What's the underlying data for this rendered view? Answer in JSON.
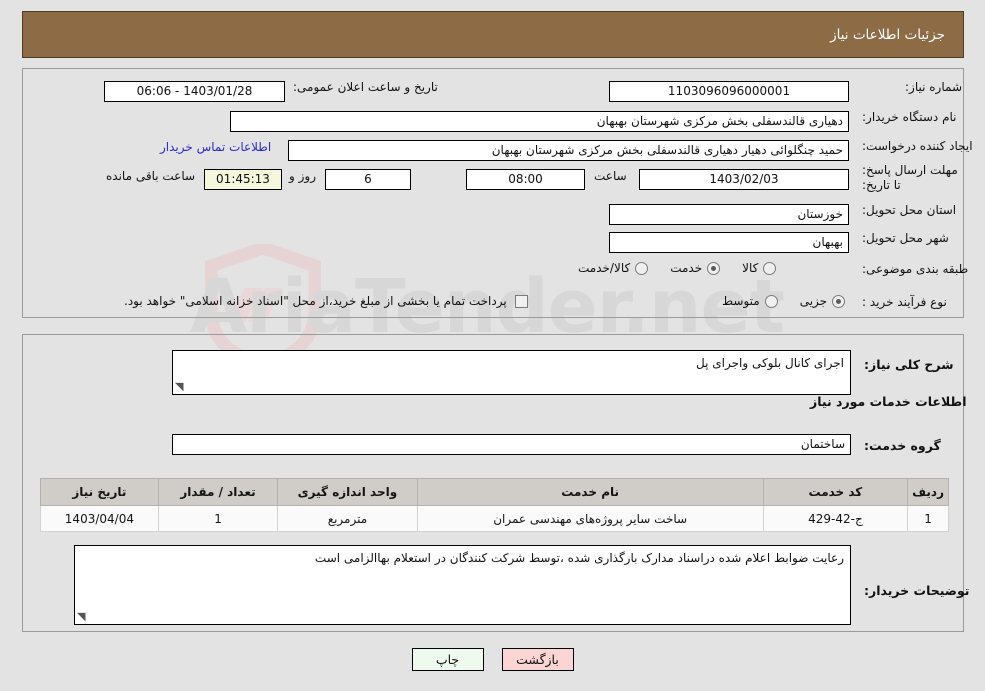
{
  "window": {
    "title": "جزئیات اطلاعات نیاز"
  },
  "watermark": {
    "text": "AriaTender.net",
    "shield_color": "#e8c9cb"
  },
  "top_panel": {
    "need_number": {
      "label": "شماره نیاز:",
      "value": "1103096096000001"
    },
    "announce_datetime": {
      "label": "تاریخ و ساعت اعلان عمومی:",
      "value": "1403/01/28 - 06:06"
    },
    "buyer_org": {
      "label": "نام دستگاه خریدار:",
      "value": "دهیاری قالندسفلی بخش مرکزی شهرستان بهبهان"
    },
    "request_creator": {
      "label": "ایجاد کننده درخواست:",
      "value": "حمید چنگلوائی دهیار دهیاری قالندسفلی بخش مرکزی شهرستان بهبهان",
      "contact_link": "اطلاعات تماس خریدار"
    },
    "deadline": {
      "label": "مهلت ارسال پاسخ: تا تاریخ:",
      "date": "1403/02/03",
      "time_label": "ساعت",
      "time": "08:00",
      "days": "6",
      "days_suffix": "روز و",
      "countdown": "01:45:13",
      "countdown_suffix": "ساعت باقی مانده"
    },
    "province": {
      "label": "استان محل تحویل:",
      "value": "خوزستان"
    },
    "city": {
      "label": "شهر محل تحویل:",
      "value": "بهبهان"
    },
    "category": {
      "label": "طبقه بندی موضوعی:",
      "options": [
        {
          "text": "کالا",
          "selected": false
        },
        {
          "text": "خدمت",
          "selected": true
        },
        {
          "text": "کالا/خدمت",
          "selected": false
        }
      ]
    },
    "process_type": {
      "label": "نوع فرآیند خرید :",
      "options": [
        {
          "text": "جزیی",
          "selected": true
        },
        {
          "text": "متوسط",
          "selected": false
        }
      ],
      "treasury_checkbox": {
        "checked": false,
        "text": "پرداخت تمام یا بخشی از مبلغ خرید،از محل \"اسناد خزانه اسلامی\" خواهد بود."
      }
    }
  },
  "middle_panel": {
    "general_desc": {
      "label": "شرح کلی نیاز:",
      "value": "اجرای کانال بلوکی واجرای پل"
    },
    "services_section_title": "اطلاعات خدمات مورد نیاز",
    "service_group": {
      "label": "گروه خدمت:",
      "value": "ساختمان"
    },
    "table": {
      "headers": [
        "ردیف",
        "کد خدمت",
        "نام خدمت",
        "واحد اندازه گیری",
        "تعداد / مقدار",
        "تاریخ نیاز"
      ],
      "rows": [
        {
          "row_no": "1",
          "service_code": "ج-42-429",
          "service_name": "ساخت سایر پروژه‌های مهندسی عمران",
          "unit": "مترمربع",
          "quantity": "1",
          "need_date": "1403/04/04"
        }
      ]
    },
    "buyer_notes": {
      "label": "توضیحات خریدار:",
      "value": "رعایت ضوابط اعلام شده دراسناد مدارک بارگذاری شده ،توسط شرکت کنندگان در استعلام بهاالزامی است"
    }
  },
  "buttons": {
    "print": "چاپ",
    "back": "بازگشت"
  }
}
